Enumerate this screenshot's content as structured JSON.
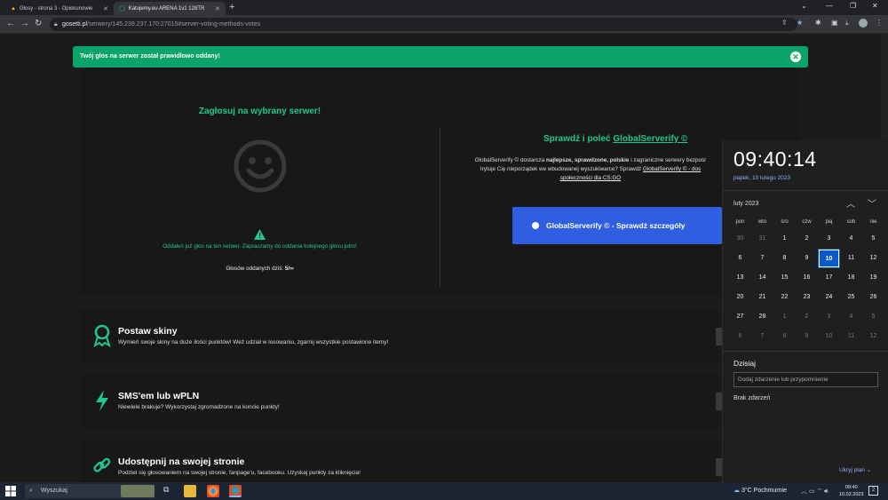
{
  "browser": {
    "tabs": [
      {
        "title": "Głosy - strona 3 - Opiekunowie",
        "active": false
      },
      {
        "title": "Katujemy.eu ARENA 1v1 128TR",
        "active": true
      }
    ],
    "url_host": "gosetti.pl",
    "url_path": "/serwery/145.239.237.170:27015#server-voting-methods-votes"
  },
  "page": {
    "alert": "Twój głos na serwer został prawidłowo oddany!",
    "vote_title": "Zagłosuj na wybrany serwer!",
    "voted_message": "Oddałeś już głos na ten serwer. Zapraszamy do oddania kolejnego głosu jutro!",
    "votes_today_label": "Głosów oddanych dziś:",
    "votes_today_value": "5/∞",
    "gs_title_prefix": "Sprawdź i poleć",
    "gs_title_link": "GlobalServerify ©",
    "gs_desc_1": "GlobalServerify © dostarcza",
    "gs_desc_bold": "najlepsze, sprawdzone, polskie",
    "gs_desc_2": "i zagraniczne serwery bezpośr",
    "gs_desc_3": "Irytuje Cię nieporządek we wbudowanej wyszukiwarce? Sprawdź",
    "gs_desc_link": "GlobalServerify © - dos",
    "gs_desc_link2": "społeczności dla CS:GO",
    "gs_button": "GlobalServerify © - Sprawdź szczegóły",
    "cards": [
      {
        "title": "Postaw skiny",
        "desc": "Wymień swoje skiny na duże ilości punktów! Weź udział w losowaniu, zgarnij wszystkie postawione itemy!",
        "icon": "award-icon"
      },
      {
        "title": "SMS'em lub wPLN",
        "desc": "Niewiele brakuje? Wykorzystaj zgromadzone na koncie punkty!",
        "icon": "lightning-icon"
      },
      {
        "title": "Udostępnij na swojej stronie",
        "desc": "Podziel się głosowaniem na swojej stronie, fanpage'u, facebooku. Uzyskaj punkty za kliknięcia!",
        "icon": "link-icon"
      }
    ],
    "accent_color": "#1ec98a",
    "button_color": "#2f5fe0"
  },
  "calendar": {
    "time": "09:40:14",
    "date": "piątek, 10 lutego 2023",
    "month": "luty 2023",
    "weekdays": [
      "pon",
      "wto",
      "śro",
      "czw",
      "pią",
      "sob",
      "nie"
    ],
    "weeks": [
      [
        "30",
        "31",
        "1",
        "2",
        "3",
        "4",
        "5"
      ],
      [
        "6",
        "7",
        "8",
        "9",
        "10",
        "11",
        "12"
      ],
      [
        "13",
        "14",
        "15",
        "16",
        "17",
        "18",
        "19"
      ],
      [
        "20",
        "21",
        "22",
        "23",
        "24",
        "25",
        "26"
      ],
      [
        "27",
        "28",
        "1",
        "2",
        "3",
        "4",
        "5"
      ],
      [
        "6",
        "7",
        "8",
        "9",
        "10",
        "11",
        "12"
      ]
    ],
    "today": "10",
    "today_label": "Dzisiaj",
    "add_placeholder": "Dodaj zdarzenie lub przypomnienie",
    "no_events": "Brak zdarzeń",
    "hide_plan": "Ukryj plan"
  },
  "taskbar": {
    "search": "Wyszukaj",
    "weather": "3°C  Pochmurnie",
    "time": "09:40",
    "date": "10.02.2023",
    "notif_count": "2"
  }
}
